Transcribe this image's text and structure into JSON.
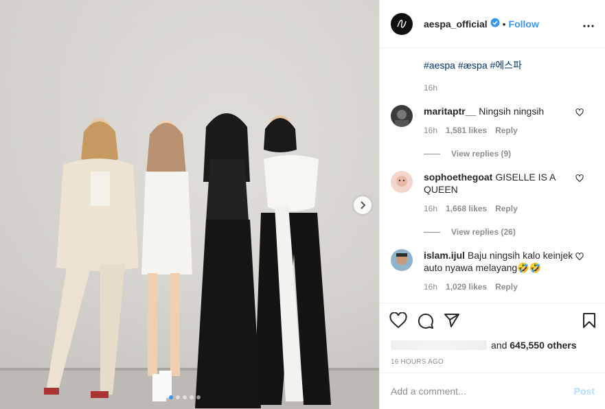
{
  "post": {
    "username": "aespa_official",
    "follow_label": "Follow",
    "bullet": "•",
    "caption_tags": "#aespa #æspa #에스파",
    "caption_time": "16h",
    "carousel_total": 5,
    "carousel_active": 1
  },
  "comments": [
    {
      "user": "maritaptr__",
      "text": "Ningsih ningsih",
      "time": "16h",
      "likes": "1,581 likes",
      "reply": "Reply",
      "view_replies": "View replies (9)"
    },
    {
      "user": "sophoethegoat",
      "text": "GISELLE IS A QUEEN",
      "time": "16h",
      "likes": "1,668 likes",
      "reply": "Reply",
      "view_replies": "View replies (26)"
    },
    {
      "user": "islam.ijul",
      "text": "Baju ningsih kalo keinjek auto nyawa melayang🤣🤣",
      "time": "16h",
      "likes": "1,029 likes",
      "reply": "Reply"
    }
  ],
  "likes": {
    "prefix": "and",
    "count": "645,550 others"
  },
  "timestamp": "16 HOURS AGO",
  "add_comment": {
    "placeholder": "Add a comment...",
    "post_label": "Post"
  },
  "colors": {
    "link": "#3897f0",
    "hashtag": "#003569",
    "muted": "#8e8e8e"
  }
}
